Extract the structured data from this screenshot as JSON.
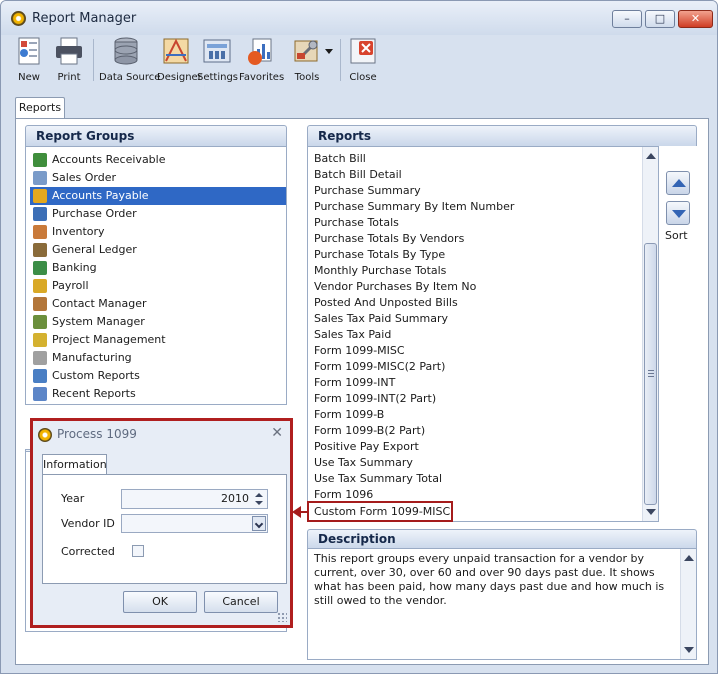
{
  "window": {
    "title": "Report Manager",
    "controls": {
      "minimize": "–",
      "maximize": "□",
      "close": "✕"
    }
  },
  "toolbar": {
    "new": "New",
    "print": "Print",
    "data_source": "Data Source",
    "designer": "Designer",
    "settings": "Settings",
    "favorites": "Favorites",
    "tools": "Tools",
    "close": "Close"
  },
  "tabs": {
    "reports": "Reports"
  },
  "report_groups": {
    "header": "Report Groups",
    "items": [
      {
        "label": "Accounts Receivable",
        "icon": "accounts-receivable-icon",
        "color": "#3f8e3c"
      },
      {
        "label": "Sales Order",
        "icon": "sales-order-icon",
        "color": "#7a9bc9"
      },
      {
        "label": "Accounts Payable",
        "icon": "accounts-payable-icon",
        "color": "#e4a81e"
      },
      {
        "label": "Purchase Order",
        "icon": "purchase-order-icon",
        "color": "#3c6fb7"
      },
      {
        "label": "Inventory",
        "icon": "inventory-icon",
        "color": "#c97a3a"
      },
      {
        "label": "General Ledger",
        "icon": "general-ledger-icon",
        "color": "#8a6b3a"
      },
      {
        "label": "Banking",
        "icon": "banking-icon",
        "color": "#3c8e47"
      },
      {
        "label": "Payroll",
        "icon": "payroll-icon",
        "color": "#d9a927"
      },
      {
        "label": "Contact Manager",
        "icon": "contact-manager-icon",
        "color": "#b3763a"
      },
      {
        "label": "System Manager",
        "icon": "system-manager-icon",
        "color": "#6b8f3c"
      },
      {
        "label": "Project Management",
        "icon": "project-management-icon",
        "color": "#d4b12f"
      },
      {
        "label": "Manufacturing",
        "icon": "manufacturing-icon",
        "color": "#a0a0a0"
      },
      {
        "label": "Custom Reports",
        "icon": "custom-reports-icon",
        "color": "#4a7fc4"
      },
      {
        "label": "Recent Reports",
        "icon": "recent-reports-icon",
        "color": "#5d86c8"
      }
    ],
    "selected": "Accounts Payable"
  },
  "reports": {
    "header": "Reports",
    "items": [
      "Batch Bill",
      "Batch Bill Detail",
      "Purchase Summary",
      "Purchase Summary By Item Number",
      "Purchase Totals",
      "Purchase Totals By Vendors",
      "Purchase Totals By Type",
      "Monthly Purchase Totals",
      "Vendor Purchases By Item No",
      "Posted And Unposted Bills",
      "Sales Tax Paid Summary",
      "Sales Tax Paid",
      "Form 1099-MISC",
      "Form 1099-MISC(2 Part)",
      "Form 1099-INT",
      "Form 1099-INT(2 Part)",
      "Form 1099-B",
      "Form 1099-B(2 Part)",
      "Positive Pay Export",
      "Use Tax Summary",
      "Use Tax Summary Total",
      "Form 1096",
      "Custom Form 1099-MISC"
    ],
    "highlighted": "Custom Form 1099-MISC",
    "sort_label": "Sort"
  },
  "description": {
    "header": "Description",
    "text": "This report groups every unpaid transaction for a vendor by current, over 30, over 60 and over 90 days past due. It shows what has been paid, how many days past due and how much is still owed to the vendor."
  },
  "dialog": {
    "title": "Process 1099",
    "tab": "Information",
    "year_label": "Year",
    "year_value": "2010",
    "vendor_label": "Vendor ID",
    "vendor_value": "",
    "corrected_label": "Corrected",
    "ok": "OK",
    "cancel": "Cancel"
  },
  "colors": {
    "selection": "#2f68c5",
    "callout": "#b01f1f"
  }
}
